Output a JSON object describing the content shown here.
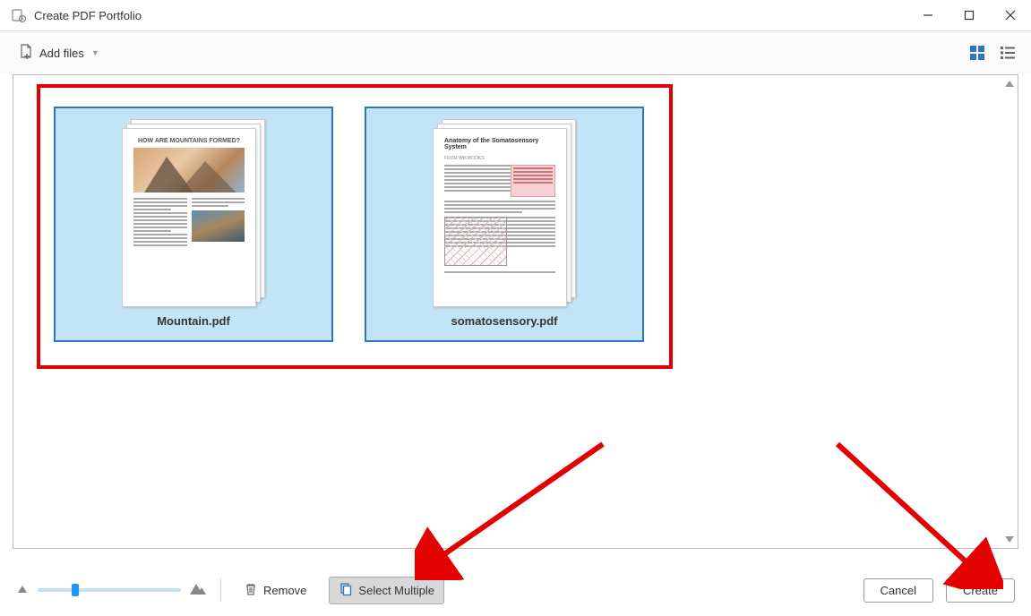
{
  "window": {
    "title": "Create PDF Portfolio"
  },
  "toolbar": {
    "add_files_label": "Add files"
  },
  "files": [
    {
      "name": "Mountain.pdf",
      "preview_heading": "HOW ARE MOUNTAINS FORMED?"
    },
    {
      "name": "somatosensory.pdf",
      "preview_heading": "Anatomy of the Somatosensory System"
    }
  ],
  "footer": {
    "remove_label": "Remove",
    "select_multiple_label": "Select Multiple",
    "cancel_label": "Cancel",
    "create_label": "Create"
  },
  "annotations": {
    "arrows_color": "#e30000"
  }
}
